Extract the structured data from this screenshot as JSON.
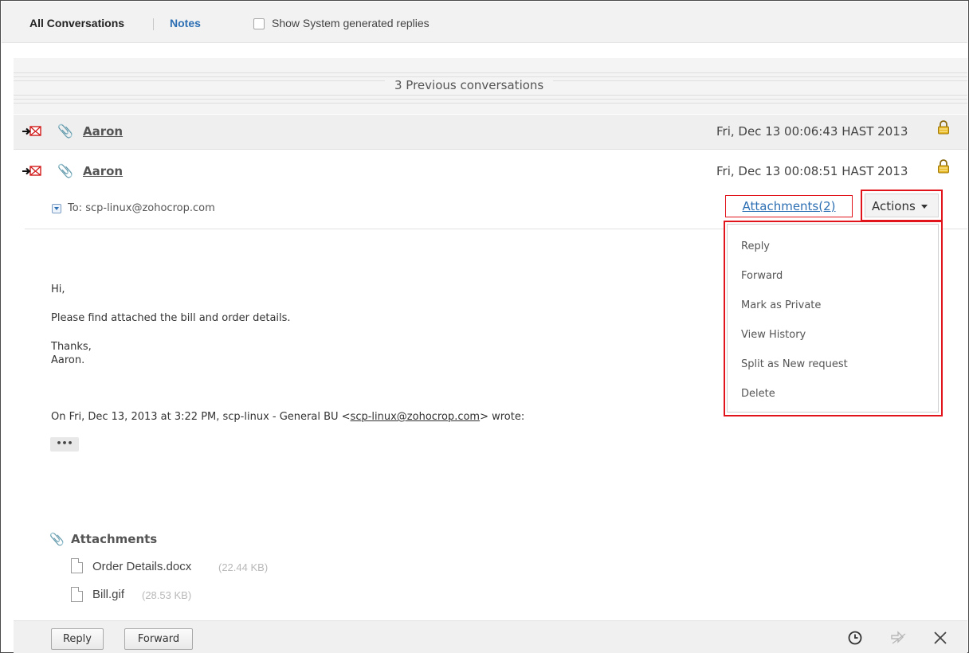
{
  "tabs": {
    "all_conversations": "All Conversations",
    "notes": "Notes",
    "show_system_replies": "Show System generated replies"
  },
  "previous": {
    "label": "3 Previous conversations"
  },
  "conversations": [
    {
      "sender": "Aaron",
      "date": "Fri, Dec 13 00:06:43 HAST 2013"
    },
    {
      "sender": "Aaron",
      "date": "Fri, Dec 13 00:08:51 HAST 2013"
    }
  ],
  "message": {
    "to_label": "To: ",
    "to_address": "scp-linux@zohocrop.com",
    "attachments_link": "Attachments(2)",
    "actions_label": "Actions",
    "body": {
      "greeting": "Hi,",
      "line1": "Please find attached the bill and order details.",
      "thanks": "Thanks,",
      "signature": "Aaron.",
      "quote_prefix": "On Fri, Dec 13, 2013 at 3:22 PM, scp-linux - General BU <",
      "quote_email": "scp-linux@zohocrop.com",
      "quote_suffix": "> wrote:",
      "ellipsis": "•••"
    }
  },
  "actions_menu": [
    "Reply",
    "Forward",
    "Mark as Private",
    "View History",
    "Split as New request",
    "Delete"
  ],
  "attachments": {
    "title": "Attachments",
    "files": [
      {
        "name": "Order Details.docx",
        "size": "(22.44 KB)"
      },
      {
        "name": "Bill.gif",
        "size": "(28.53 KB)"
      }
    ]
  },
  "footer": {
    "reply": "Reply",
    "forward": "Forward"
  },
  "colors": {
    "highlight": "#e0141a",
    "link": "#2d6fb3"
  },
  "icons": [
    "incoming-mail-icon",
    "paperclip-icon",
    "lock-icon",
    "expand-toggle-icon",
    "file-icon",
    "clock-icon",
    "no-reply-icon",
    "close-icon"
  ]
}
